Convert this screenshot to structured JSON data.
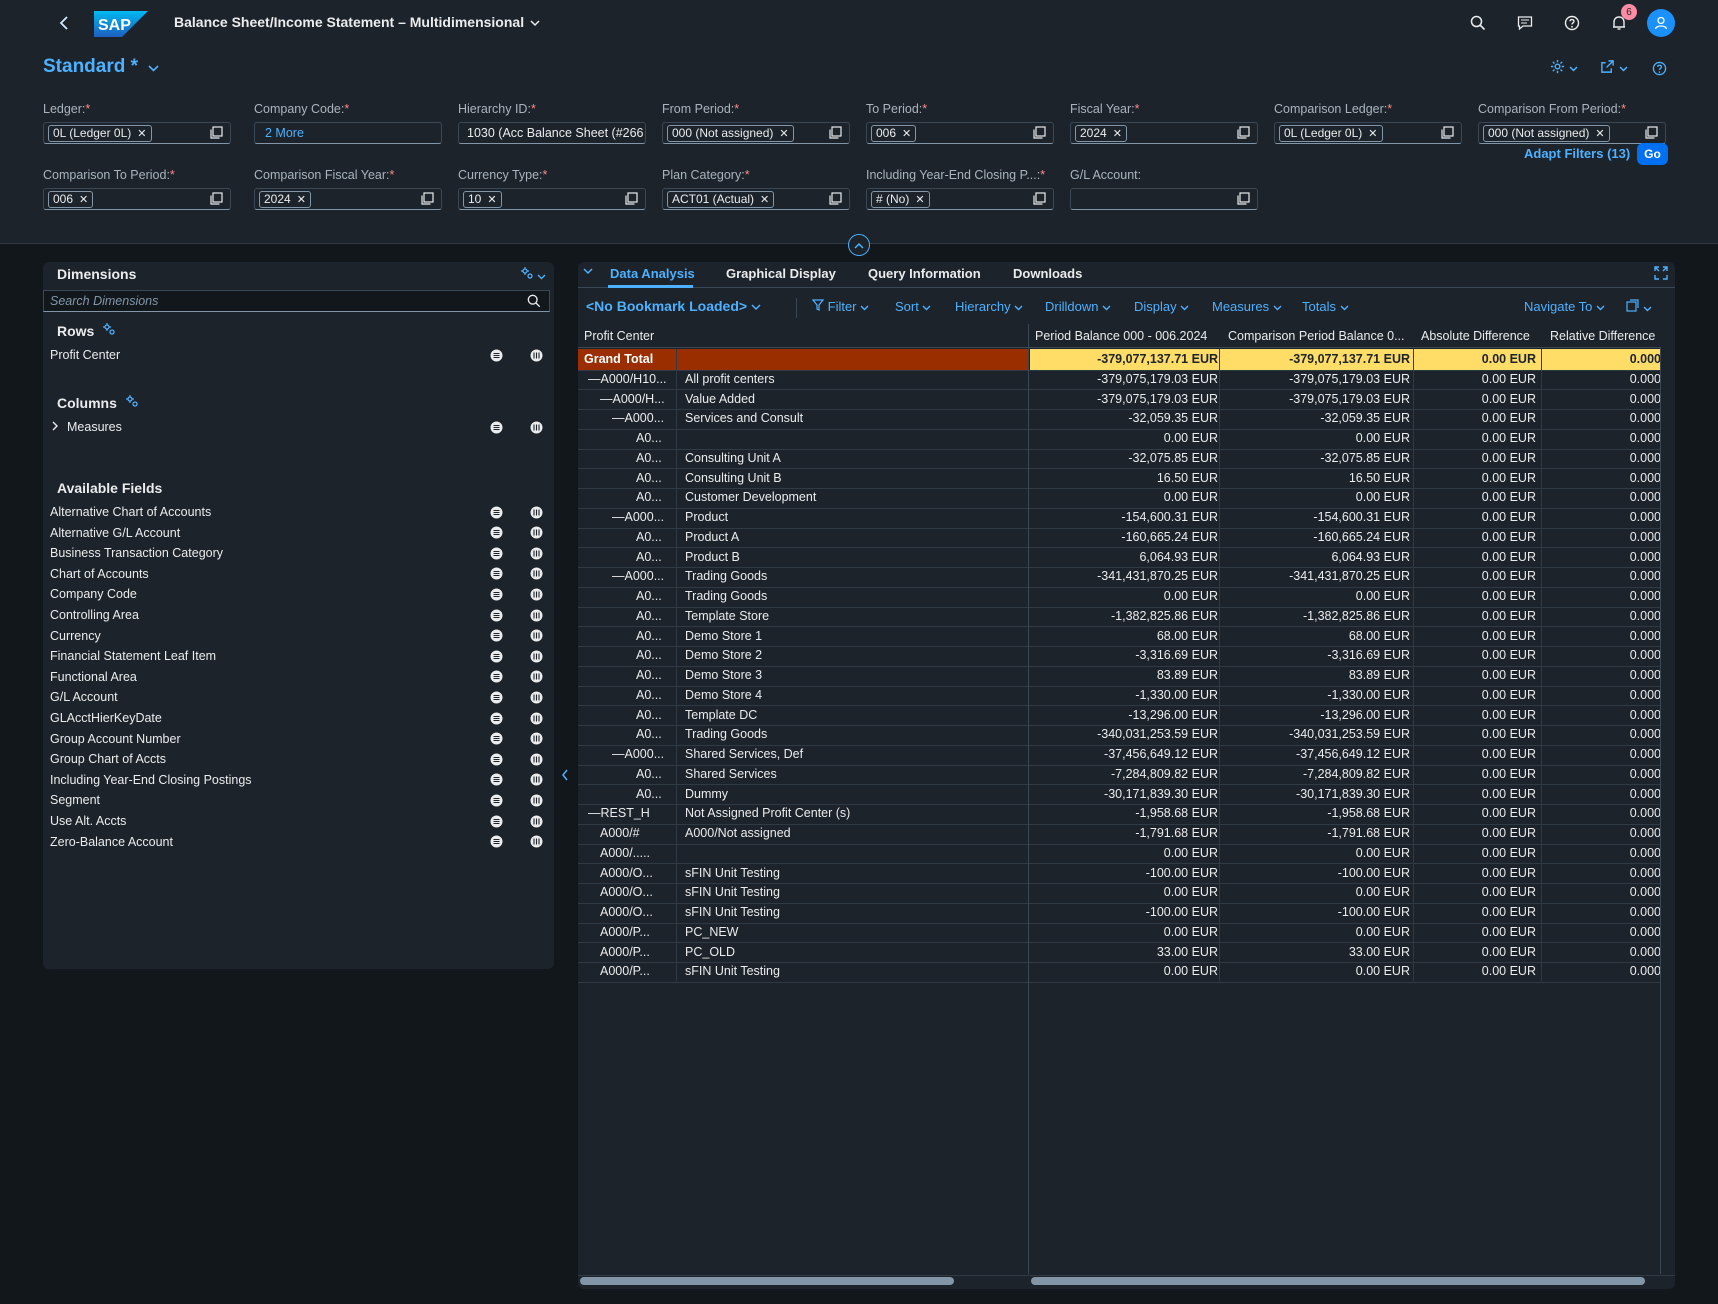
{
  "shell": {
    "logo_text": "SAP",
    "title": "Balance Sheet/Income Statement – Multidimensional",
    "notification_count": "6"
  },
  "header": {
    "variant": "Standard *",
    "adapt_filters": "Adapt Filters (13)",
    "go": "Go"
  },
  "filters": [
    {
      "label": "Ledger:",
      "token": "0L (Ledger 0L)"
    },
    {
      "label": "Company Code:",
      "more": "2 More"
    },
    {
      "label": "Hierarchy ID:",
      "text": "1030 (Acc Balance Sheet (#266"
    },
    {
      "label": "From Period:",
      "token": "000 (Not assigned)"
    },
    {
      "label": "To Period:",
      "token": "006"
    },
    {
      "label": "Fiscal Year:",
      "token": "2024"
    },
    {
      "label": "Comparison Ledger:",
      "token": "0L (Ledger 0L)"
    },
    {
      "label": "Comparison From Period:",
      "token": "000 (Not assigned)"
    },
    {
      "label": "Comparison To Period:",
      "token": "006"
    },
    {
      "label": "Comparison Fiscal Year:",
      "token": "2024"
    },
    {
      "label": "Currency Type:",
      "token": "10"
    },
    {
      "label": "Plan Category:",
      "token": "ACT01 (Actual)"
    },
    {
      "label": "Including Year-End Closing P...:",
      "token": "# (No)"
    },
    {
      "label": "G/L Account:"
    }
  ],
  "dimensions": {
    "title": "Dimensions",
    "search_placeholder": "Search Dimensions",
    "rows_title": "Rows",
    "rows": [
      "Profit Center"
    ],
    "columns_title": "Columns",
    "columns": [
      "Measures"
    ],
    "available_title": "Available Fields",
    "available": [
      "Alternative Chart of Accounts",
      "Alternative G/L Account",
      "Business Transaction Category",
      "Chart of Accounts",
      "Company Code",
      "Controlling Area",
      "Currency",
      "Financial Statement Leaf Item",
      "Functional Area",
      "G/L Account",
      "GLAcctHierKeyDate",
      "Group Account Number",
      "Group Chart of Accts",
      "Including Year-End Closing Postings",
      "Segment",
      "Use Alt. Accts",
      "Zero-Balance Account"
    ]
  },
  "tabs": [
    "Data Analysis",
    "Graphical Display",
    "Query Information",
    "Downloads"
  ],
  "toolbar": {
    "bookmark": "<No Bookmark Loaded>",
    "filter": "Filter",
    "sort": "Sort",
    "hierarchy": "Hierarchy",
    "drilldown": "Drilldown",
    "display": "Display",
    "measures": "Measures",
    "totals": "Totals",
    "navigate": "Navigate To"
  },
  "table": {
    "headers": [
      "Profit Center",
      "Period Balance 000 - 006.2024",
      "Comparison Period Balance 0...",
      "Absolute Difference",
      "Relative Difference"
    ],
    "rows": [
      {
        "key": "Grand Total",
        "text": "",
        "p": "-379,077,137.71 EUR",
        "c": "-379,077,137.71 EUR",
        "a": "0.00 EUR",
        "r": "0.000",
        "total": true
      },
      {
        "key": "—A000/H10...",
        "text": "All profit centers",
        "p": "-379,075,179.03 EUR",
        "c": "-379,075,179.03 EUR",
        "a": "0.00 EUR",
        "r": "0.000",
        "indent": 1
      },
      {
        "key": "—A000/H...",
        "text": "Value Added",
        "p": "-379,075,179.03 EUR",
        "c": "-379,075,179.03 EUR",
        "a": "0.00 EUR",
        "r": "0.000",
        "indent": 2
      },
      {
        "key": "—A000...",
        "text": "Services and Consult",
        "p": "-32,059.35 EUR",
        "c": "-32,059.35 EUR",
        "a": "0.00 EUR",
        "r": "0.000",
        "indent": 3
      },
      {
        "key": "A0...",
        "text": "",
        "p": "0.00 EUR",
        "c": "0.00 EUR",
        "a": "0.00 EUR",
        "r": "0.000",
        "indent": 4
      },
      {
        "key": "A0...",
        "text": "Consulting Unit A",
        "p": "-32,075.85 EUR",
        "c": "-32,075.85 EUR",
        "a": "0.00 EUR",
        "r": "0.000",
        "indent": 4
      },
      {
        "key": "A0...",
        "text": "Consulting Unit B",
        "p": "16.50 EUR",
        "c": "16.50 EUR",
        "a": "0.00 EUR",
        "r": "0.000",
        "indent": 4
      },
      {
        "key": "A0...",
        "text": "Customer Development",
        "p": "0.00 EUR",
        "c": "0.00 EUR",
        "a": "0.00 EUR",
        "r": "0.000",
        "indent": 4
      },
      {
        "key": "—A000...",
        "text": "Product",
        "p": "-154,600.31 EUR",
        "c": "-154,600.31 EUR",
        "a": "0.00 EUR",
        "r": "0.000",
        "indent": 3
      },
      {
        "key": "A0...",
        "text": "Product A",
        "p": "-160,665.24 EUR",
        "c": "-160,665.24 EUR",
        "a": "0.00 EUR",
        "r": "0.000",
        "indent": 4
      },
      {
        "key": "A0...",
        "text": "Product B",
        "p": "6,064.93 EUR",
        "c": "6,064.93 EUR",
        "a": "0.00 EUR",
        "r": "0.000",
        "indent": 4
      },
      {
        "key": "—A000...",
        "text": "Trading Goods",
        "p": "-341,431,870.25 EUR",
        "c": "-341,431,870.25 EUR",
        "a": "0.00 EUR",
        "r": "0.000",
        "indent": 3
      },
      {
        "key": "A0...",
        "text": "Trading Goods",
        "p": "0.00 EUR",
        "c": "0.00 EUR",
        "a": "0.00 EUR",
        "r": "0.000",
        "indent": 4
      },
      {
        "key": "A0...",
        "text": "Template Store",
        "p": "-1,382,825.86 EUR",
        "c": "-1,382,825.86 EUR",
        "a": "0.00 EUR",
        "r": "0.000",
        "indent": 4
      },
      {
        "key": "A0...",
        "text": "Demo Store 1",
        "p": "68.00 EUR",
        "c": "68.00 EUR",
        "a": "0.00 EUR",
        "r": "0.000",
        "indent": 4
      },
      {
        "key": "A0...",
        "text": "Demo Store 2",
        "p": "-3,316.69 EUR",
        "c": "-3,316.69 EUR",
        "a": "0.00 EUR",
        "r": "0.000",
        "indent": 4
      },
      {
        "key": "A0...",
        "text": "Demo Store 3",
        "p": "83.89 EUR",
        "c": "83.89 EUR",
        "a": "0.00 EUR",
        "r": "0.000",
        "indent": 4
      },
      {
        "key": "A0...",
        "text": "Demo Store 4",
        "p": "-1,330.00 EUR",
        "c": "-1,330.00 EUR",
        "a": "0.00 EUR",
        "r": "0.000",
        "indent": 4
      },
      {
        "key": "A0...",
        "text": "Template DC",
        "p": "-13,296.00 EUR",
        "c": "-13,296.00 EUR",
        "a": "0.00 EUR",
        "r": "0.000",
        "indent": 4
      },
      {
        "key": "A0...",
        "text": "Trading Goods",
        "p": "-340,031,253.59 EUR",
        "c": "-340,031,253.59 EUR",
        "a": "0.00 EUR",
        "r": "0.000",
        "indent": 4
      },
      {
        "key": "—A000...",
        "text": "Shared Services, Def",
        "p": "-37,456,649.12 EUR",
        "c": "-37,456,649.12 EUR",
        "a": "0.00 EUR",
        "r": "0.000",
        "indent": 3
      },
      {
        "key": "A0...",
        "text": "Shared Services",
        "p": "-7,284,809.82 EUR",
        "c": "-7,284,809.82 EUR",
        "a": "0.00 EUR",
        "r": "0.000",
        "indent": 4
      },
      {
        "key": "A0...",
        "text": "Dummy",
        "p": "-30,171,839.30 EUR",
        "c": "-30,171,839.30 EUR",
        "a": "0.00 EUR",
        "r": "0.000",
        "indent": 4
      },
      {
        "key": "—REST_H",
        "text": "Not Assigned Profit Center (s)",
        "p": "-1,958.68 EUR",
        "c": "-1,958.68 EUR",
        "a": "0.00 EUR",
        "r": "0.000",
        "indent": 1
      },
      {
        "key": "A000/#",
        "text": "A000/Not assigned",
        "p": "-1,791.68 EUR",
        "c": "-1,791.68 EUR",
        "a": "0.00 EUR",
        "r": "0.000",
        "indent": 2
      },
      {
        "key": "A000/.....",
        "text": "",
        "p": "0.00 EUR",
        "c": "0.00 EUR",
        "a": "0.00 EUR",
        "r": "0.000",
        "indent": 2
      },
      {
        "key": "A000/O...",
        "text": "sFIN Unit Testing",
        "p": "-100.00 EUR",
        "c": "-100.00 EUR",
        "a": "0.00 EUR",
        "r": "0.000",
        "indent": 2
      },
      {
        "key": "A000/O...",
        "text": "sFIN Unit Testing",
        "p": "0.00 EUR",
        "c": "0.00 EUR",
        "a": "0.00 EUR",
        "r": "0.000",
        "indent": 2
      },
      {
        "key": "A000/O...",
        "text": "sFIN Unit Testing",
        "p": "-100.00 EUR",
        "c": "-100.00 EUR",
        "a": "0.00 EUR",
        "r": "0.000",
        "indent": 2
      },
      {
        "key": "A000/P...",
        "text": "PC_NEW",
        "p": "0.00 EUR",
        "c": "0.00 EUR",
        "a": "0.00 EUR",
        "r": "0.000",
        "indent": 2
      },
      {
        "key": "A000/P...",
        "text": "PC_OLD",
        "p": "33.00 EUR",
        "c": "33.00 EUR",
        "a": "0.00 EUR",
        "r": "0.000",
        "indent": 2
      },
      {
        "key": "A000/P...",
        "text": "sFIN Unit Testing",
        "p": "0.00 EUR",
        "c": "0.00 EUR",
        "a": "0.00 EUR",
        "r": "0.000",
        "indent": 2
      }
    ]
  }
}
